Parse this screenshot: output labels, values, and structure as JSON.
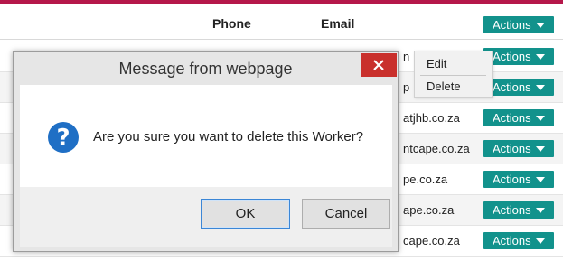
{
  "table": {
    "headers": {
      "phone": "Phone",
      "email": "Email"
    },
    "actions_label": "Actions",
    "rows": [
      {
        "email_fragment": "n",
        "alt": false
      },
      {
        "email_fragment": "p",
        "alt": true
      },
      {
        "email_fragment": "atjhb.co.za",
        "alt": false
      },
      {
        "email_fragment": "ntcape.co.za",
        "alt": true
      },
      {
        "email_fragment": "pe.co.za",
        "alt": false
      },
      {
        "email_fragment": "ape.co.za",
        "alt": true
      },
      {
        "email_fragment": "cape.co.za",
        "alt": false
      }
    ]
  },
  "dropdown": {
    "edit": "Edit",
    "delete": "Delete"
  },
  "dialog": {
    "title": "Message from webpage",
    "message": "Are you sure you want to delete this Worker?",
    "ok_label": "OK",
    "cancel_label": "Cancel"
  },
  "colors": {
    "accent_rule": "#b5174a",
    "actions_button": "#12928c",
    "dialog_close": "#c9302c",
    "question_icon": "#1f6fc5"
  }
}
